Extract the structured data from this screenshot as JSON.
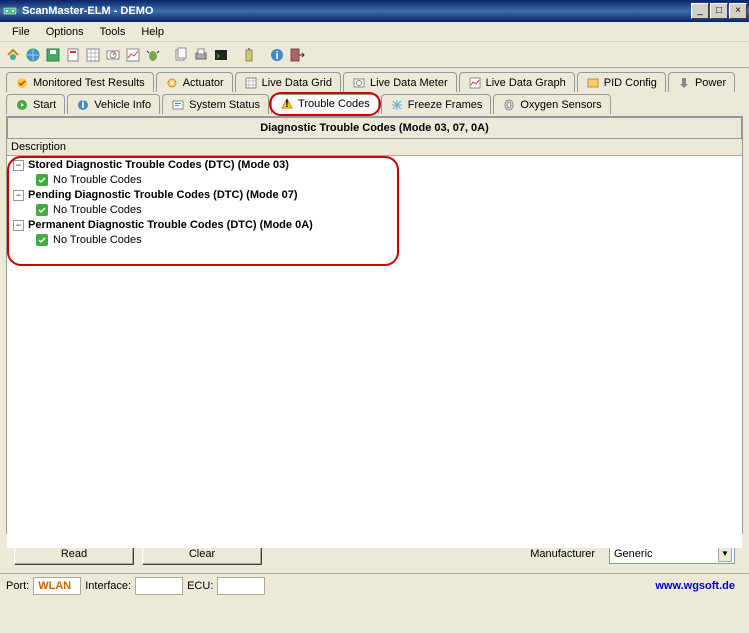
{
  "window": {
    "title": "ScanMaster-ELM - DEMO"
  },
  "menu": {
    "file": "File",
    "options": "Options",
    "tools": "Tools",
    "help": "Help"
  },
  "tabs_row1": {
    "monitored": "Monitored Test Results",
    "actuator": "Actuator",
    "live_grid": "Live Data Grid",
    "live_meter": "Live Data Meter",
    "live_graph": "Live Data Graph",
    "pid": "PID Config",
    "power": "Power"
  },
  "tabs_row2": {
    "start": "Start",
    "vehicle": "Vehicle Info",
    "system": "System Status",
    "trouble": "Trouble Codes",
    "freeze": "Freeze Frames",
    "oxygen": "Oxygen Sensors"
  },
  "panel": {
    "title": "Diagnostic Trouble Codes (Mode 03, 07, 0A)",
    "description_header": "Description"
  },
  "tree": {
    "stored": {
      "label": "Stored Diagnostic Trouble Codes (DTC) (Mode 03)",
      "child": "No Trouble Codes"
    },
    "pending": {
      "label": "Pending Diagnostic Trouble Codes (DTC) (Mode 07)",
      "child": "No Trouble Codes"
    },
    "permanent": {
      "label": "Permanent Diagnostic Trouble Codes (DTC) (Mode 0A)",
      "child": "No Trouble Codes"
    }
  },
  "buttons": {
    "read": "Read",
    "clear": "Clear"
  },
  "manufacturer": {
    "label": "Manufacturer",
    "value": "Generic"
  },
  "status": {
    "port": "Port:",
    "wlan": "WLAN",
    "interface": "Interface:",
    "ecu": "ECU:",
    "url": "www.wgsoft.de"
  }
}
